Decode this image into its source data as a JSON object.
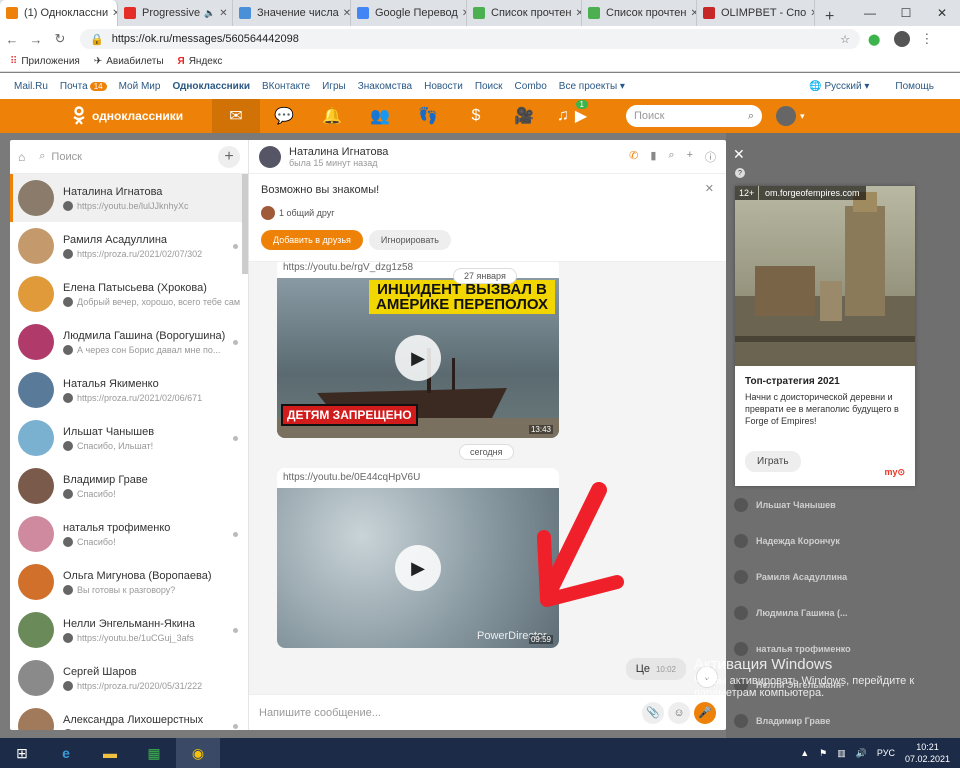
{
  "browser": {
    "tabs": [
      {
        "title": "(1) Одноклассни",
        "color": "#ee8208",
        "active": true
      },
      {
        "title": "Progressive",
        "color": "#e52d27",
        "audio": true
      },
      {
        "title": "Значение числа",
        "color": "#4a90d9"
      },
      {
        "title": "Google Перевод",
        "color": "#4285f4"
      },
      {
        "title": "Список прочтен",
        "color": "#4caf50"
      },
      {
        "title": "Список прочтен",
        "color": "#4caf50"
      },
      {
        "title": "OLIMPBET - Спо",
        "color": "#c62828"
      }
    ],
    "url": "https://ok.ru/messages/560564442098",
    "bookmarks": [
      "Приложения",
      "Авиабилеты",
      "Яндекс"
    ]
  },
  "ok_top": {
    "links": [
      "Mail.Ru",
      "Почта",
      "Мой Мир",
      "Одноклассники",
      "ВКонтакте",
      "Игры",
      "Знакомства",
      "Новости",
      "Поиск",
      "Combo",
      "Все проекты ▾"
    ],
    "mail_badge": "14",
    "lang": "Русский ▾",
    "help": "Помощь"
  },
  "orange_bar": {
    "logo_text": "одноклассники",
    "music_badge": "1",
    "search_placeholder": "Поиск"
  },
  "contacts": {
    "search_placeholder": "Поиск",
    "items": [
      {
        "name": "Наталина Игнатова",
        "preview": "https://youtu.be/lulJJknhyXc",
        "color": "#8a7b6a",
        "selected": true
      },
      {
        "name": "Рамиля Асадуллина",
        "preview": "https://proza.ru/2021/02/07/302",
        "color": "#c49a6c"
      },
      {
        "name": "Елена Патысьева (Хрокова)",
        "preview": "Добрый вечер, хорошо, всего тебе сам...",
        "color": "#e09a3a"
      },
      {
        "name": "Людмила Гашина (Ворогушина)",
        "preview": "А через сон Борис давал мне по...",
        "color": "#b03a6a"
      },
      {
        "name": "Наталья Якименко",
        "preview": "https://proza.ru/2021/02/06/671",
        "color": "#5a7a9a"
      },
      {
        "name": "Ильшат Чанышев",
        "preview": "Спасибо, Ильшат!",
        "color": "#7ab0d0"
      },
      {
        "name": "Владимир Граве",
        "preview": "Спасибо!",
        "color": "#7a5a4a"
      },
      {
        "name": "наталья трофименко",
        "preview": "Спасибо!",
        "color": "#d08aa0"
      },
      {
        "name": "Ольга Мигунова (Воропаева)",
        "preview": "Вы готовы к разговору?",
        "color": "#d0702a"
      },
      {
        "name": "Нелли Энгельманн-Якина",
        "preview": "https://youtu.be/1uCGuj_3afs",
        "color": "#6a8a5a"
      },
      {
        "name": "Сергей Шаров",
        "preview": "https://proza.ru/2020/05/31/222",
        "color": "#8a8a8a"
      },
      {
        "name": "Александра Лихошерстных",
        "preview": "",
        "color": "#a07a5a"
      }
    ]
  },
  "chat": {
    "name": "Наталина Игнатова",
    "status": "была 15 минут назад",
    "suggest_title": "Возможно вы знакомы!",
    "suggest_friends": "1 общий друг",
    "add_btn": "Добавить в друзья",
    "ignore_btn": "Игнорировать",
    "video1_url": "https://youtu.be/rgV_dzg1z58",
    "video1_banner_top": "ИНЦИДЕНТ ВЫЗВАЛ В АМЕРИКЕ ПЕРЕПОЛОХ",
    "video1_banner_bottom": "ДЕТЯМ ЗАПРЕЩЕНО",
    "video1_duration": "13:43",
    "date1": "27 января",
    "date2": "сегодня",
    "video2_url": "https://youtu.be/0E44cqHpV6U",
    "video2_watermark": "PowerDirector",
    "video2_duration": "09:59",
    "msg_text": "Це",
    "msg_time": "10:02",
    "composer_placeholder": "Напишите сообщение..."
  },
  "right_panel": {
    "items": [
      "Ильшат Чанышев",
      "Надежда Корончук",
      "Рамиля Асадуллина",
      "Людмила Гашина (...",
      "наталья трофименко",
      "Нелли Энгельманн-",
      "Владимир Граве"
    ],
    "ad_age": "12+",
    "ad_domain": "om.forgeofempires.com",
    "ad_title": "Топ-стратегия 2021",
    "ad_desc": "Начни с доисторической деревни и преврати ее в мегаполис будущего в Forge of Empires!",
    "ad_btn": "Играть",
    "ad_mark": "mytarget"
  },
  "activation": {
    "title": "Активация Windows",
    "sub": "Чтобы активировать Windows, перейдите к параметрам компьютера."
  },
  "taskbar": {
    "lang": "РУС",
    "time": "10:21",
    "date": "07.02.2021"
  },
  "colors": {
    "accent": "#ee8208",
    "link": "#2a5885"
  }
}
